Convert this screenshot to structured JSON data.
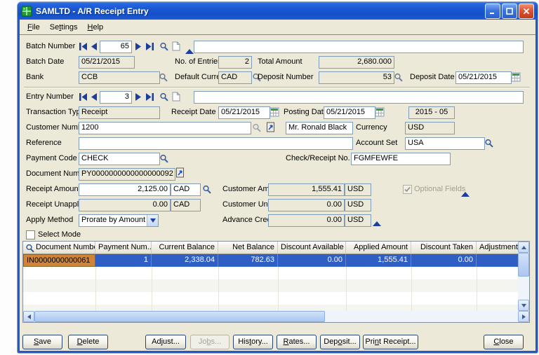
{
  "window": {
    "title": "SAMLTD - A/R Receipt Entry"
  },
  "menu": {
    "file": {
      "pre": "",
      "u": "F",
      "post": "ile"
    },
    "settings": {
      "pre": "Se",
      "u": "t",
      "post": "tings"
    },
    "help": {
      "pre": "",
      "u": "H",
      "post": "elp"
    }
  },
  "batch": {
    "number_label": "Batch Number",
    "number": "65",
    "description": "",
    "date_label": "Batch Date",
    "date": "05/21/2015",
    "entries_label": "No. of Entries",
    "entries": "2",
    "total_label": "Total Amount",
    "total": "2,680.000",
    "bank_label": "Bank",
    "bank": "CCB",
    "default_currency_label": "Default Currency",
    "default_currency": "CAD",
    "deposit_number_label": "Deposit Number",
    "deposit_number": "53",
    "deposit_date_label": "Deposit Date",
    "deposit_date": "05/21/2015"
  },
  "entry": {
    "number_label": "Entry Number",
    "number": "3",
    "description": "",
    "transaction_type_label": "Transaction Type",
    "transaction_type": "Receipt",
    "receipt_date_label": "Receipt Date",
    "receipt_date": "05/21/2015",
    "posting_date_label": "Posting Date",
    "posting_date": "05/21/2015",
    "fiscal_period": "2015 - 05",
    "customer_number_label": "Customer Number",
    "customer_number": "1200",
    "customer_name": "Mr. Ronald Black",
    "currency_label": "Currency",
    "currency": "USD",
    "reference_label": "Reference",
    "reference": "",
    "account_set_label": "Account Set",
    "account_set": "USA",
    "payment_code_label": "Payment Code",
    "payment_code": "CHECK",
    "check_receipt_no_label": "Check/Receipt No.",
    "check_receipt_no": "FGMFEWFE",
    "document_number_label": "Document Number",
    "document_number": "PY0000000000000000092"
  },
  "amounts": {
    "receipt_amount_label": "Receipt Amount",
    "receipt_amount": "2,125.00",
    "receipt_amount_currency": "CAD",
    "receipt_unapplied_label": "Receipt Unapplied",
    "receipt_unapplied": "0.00",
    "receipt_unapplied_currency": "CAD",
    "apply_method_label": "Apply Method",
    "apply_method": "Prorate by Amount",
    "customer_amount_label": "Customer Amount",
    "customer_amount": "1,555.41",
    "customer_amount_currency": "USD",
    "customer_unapplied_label": "Customer Unapplied",
    "customer_unapplied": "0.00",
    "customer_unapplied_currency": "USD",
    "advance_credit_label": "Advance Credit",
    "advance_credit": "0.00",
    "advance_credit_currency": "USD",
    "optional_fields_label": "Optional Fields",
    "select_mode_label": "Select Mode"
  },
  "grid": {
    "columns": [
      "Document Number",
      "Payment Num...",
      "Current Balance",
      "Net Balance",
      "Discount Available",
      "Applied Amount",
      "Discount Taken",
      "Adjustment"
    ],
    "rows": [
      {
        "document_number": "IN0000000000061",
        "payment_number": "1",
        "current_balance": "2,338.04",
        "net_balance": "782.63",
        "discount_available": "0.00",
        "applied_amount": "1,555.41",
        "discount_taken": "0.00",
        "adjustment": ""
      }
    ]
  },
  "buttons": {
    "save": {
      "pre": "",
      "u": "S",
      "post": "ave"
    },
    "delete": {
      "pre": "",
      "u": "D",
      "post": "elete"
    },
    "adjust": {
      "pre": "Ad",
      "u": "j",
      "post": "ust..."
    },
    "jobs": {
      "pre": "Jo",
      "u": "b",
      "post": "s..."
    },
    "history": {
      "pre": "His",
      "u": "t",
      "post": "ory..."
    },
    "rates": {
      "pre": "",
      "u": "R",
      "post": "ates..."
    },
    "deposit": {
      "pre": "Dep",
      "u": "o",
      "post": "sit..."
    },
    "print_receipt": {
      "pre": "Pri",
      "u": "n",
      "post": "t Receipt..."
    },
    "close": {
      "pre": "",
      "u": "C",
      "post": "lose"
    }
  },
  "colors": {
    "titlebar_top": "#3B8BF0",
    "titlebar_bottom": "#1450C8",
    "form_bg": "#ECE9D8",
    "field_border": "#7F9DB9",
    "selected_row": "#2F5EC4",
    "active_cell": "#CE8539",
    "close_button": "#C43A1C"
  },
  "icons": {
    "nav_first": "go-first",
    "nav_prev": "go-previous",
    "nav_next": "go-next",
    "nav_last": "go-last",
    "finder": "magnifier",
    "new_record": "new-document",
    "zoom_up": "▲",
    "calendar": "calendar-grid",
    "drilldown": "zoom-to-document",
    "dropdown": "▼"
  }
}
